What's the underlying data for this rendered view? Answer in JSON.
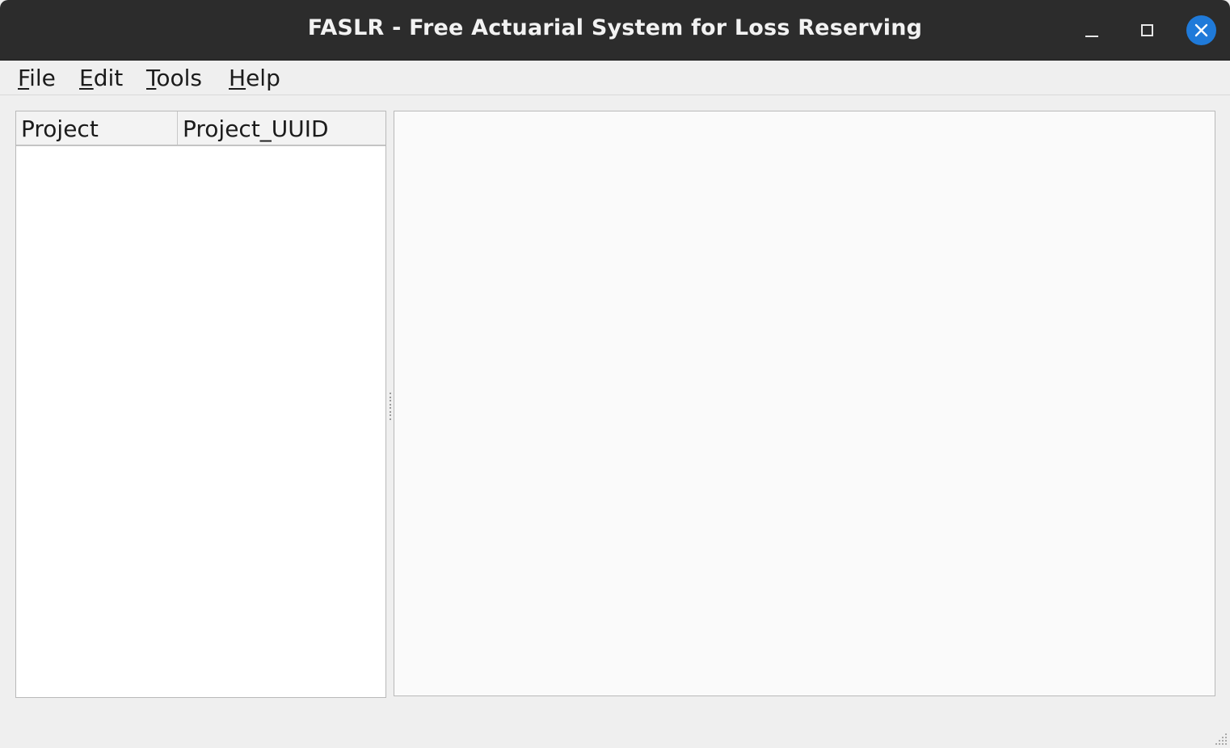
{
  "window": {
    "title": "FASLR - Free Actuarial System for Loss Reserving"
  },
  "menubar": {
    "items": [
      {
        "mnemonic": "F",
        "rest": "ile"
      },
      {
        "mnemonic": "E",
        "rest": "dit"
      },
      {
        "mnemonic": "T",
        "rest": "ools"
      },
      {
        "mnemonic": "H",
        "rest": "elp"
      }
    ]
  },
  "project_tree": {
    "columns": [
      "Project",
      "Project_UUID"
    ]
  },
  "colors": {
    "titlebar": "#2c2c2c",
    "close_button": "#1f7ad9",
    "background": "#efefef"
  }
}
